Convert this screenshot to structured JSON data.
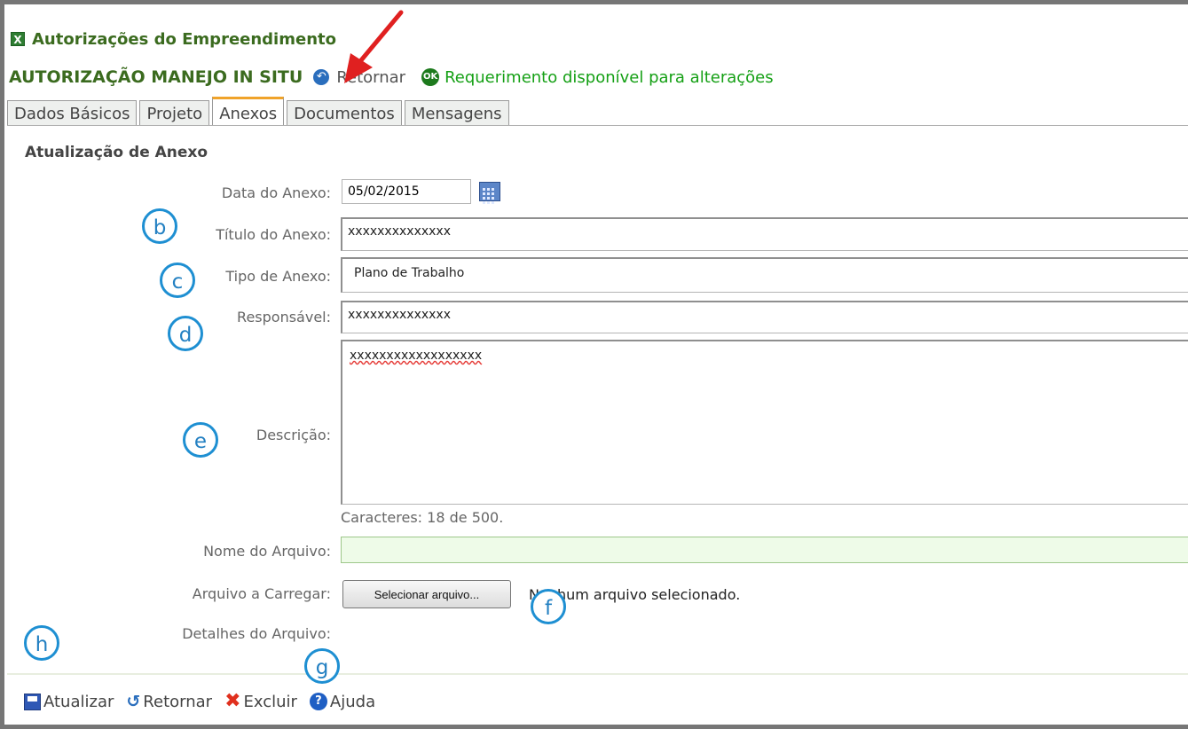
{
  "header": {
    "title": "Autorizações do Empreendimento"
  },
  "status": {
    "authorization_title": "AUTORIZAÇÃO MANEJO IN SITU",
    "return_link": "Retornar",
    "ok_icon_text": "OK",
    "message": "Requerimento disponível para alterações"
  },
  "tabs": [
    "Dados Básicos",
    "Projeto",
    "Anexos",
    "Documentos",
    "Mensagens"
  ],
  "active_tab": "Anexos",
  "form": {
    "title": "Atualização de Anexo",
    "date_label": "Data do Anexo:",
    "date_value": "05/02/2015",
    "title_label": "Título do Anexo:",
    "title_value": "xxxxxxxxxxxxxx",
    "type_label": "Tipo de Anexo:",
    "type_value": "Plano de Trabalho",
    "responsible_label": "Responsável:",
    "responsible_value": "xxxxxxxxxxxxxx",
    "description_label": "Descrição:",
    "description_value": "xxxxxxxxxxxxxxxxxx",
    "char_count": "Caracteres: 18 de 500.",
    "filename_label": "Nome do Arquivo:",
    "filename_value": "",
    "upload_label": "Arquivo a Carregar:",
    "upload_button": "Selecionar arquivo...",
    "no_file_text": "Nenhum arquivo selecionado.",
    "file_details_label": "Detalhes do Arquivo:"
  },
  "actions": {
    "update": "Atualizar",
    "return": "Retornar",
    "delete": "Excluir",
    "help": "Ajuda"
  },
  "callouts": {
    "b": "b",
    "c": "c",
    "d": "d",
    "e": "e",
    "f": "f",
    "g": "g",
    "h": "h"
  },
  "colors": {
    "header_green": "#3b6b1f",
    "status_green": "#15a015",
    "active_tab_accent": "#f0a32a",
    "callout_blue": "#1e8fd2",
    "arrow_red": "#e02020"
  }
}
